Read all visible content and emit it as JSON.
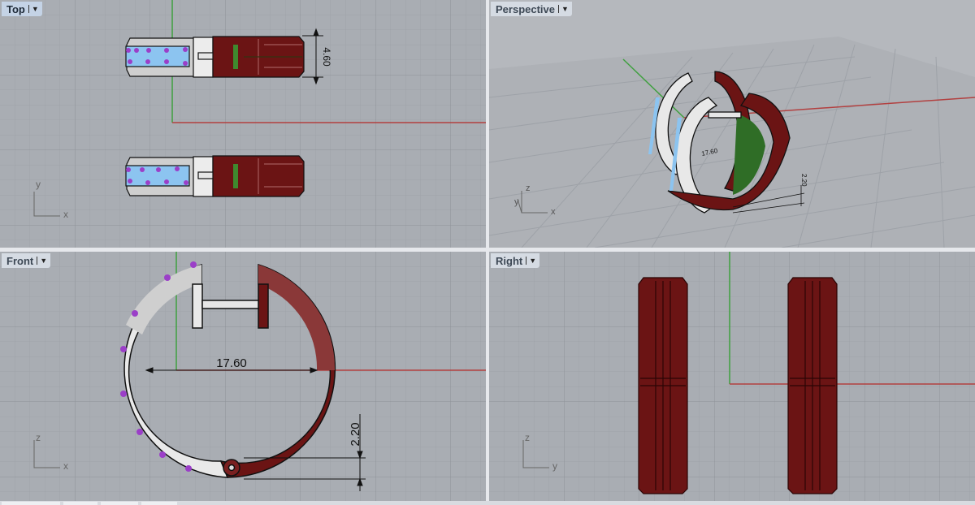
{
  "viewports": {
    "top": {
      "label": "Top",
      "dimension": "4.60",
      "axis_h": "x",
      "axis_v": "y"
    },
    "perspective": {
      "label": "Perspective",
      "dimension_diameter": "17.60",
      "dimension_height": "2.20",
      "axis_1": "x",
      "axis_2": "y",
      "axis_3": "z"
    },
    "front": {
      "label": "Front",
      "dimension_diameter": "17.60",
      "dimension_height": "2.20",
      "axis_h": "x",
      "axis_v": "z"
    },
    "right": {
      "label": "Right",
      "axis_h": "y",
      "axis_v": "z"
    }
  },
  "dropdown_icon": "triangle-down-icon",
  "colors": {
    "background": "#a9adb3",
    "grid": "#9a9ea5",
    "x_axis": "#b24040",
    "y_axis": "#3fa03f",
    "metal": "#ebebeb",
    "red_part": "#6b1414",
    "gem_blue": "#8cc4f0",
    "gem_purple": "#9b3fc8",
    "label_active": "#c4d3e6"
  }
}
